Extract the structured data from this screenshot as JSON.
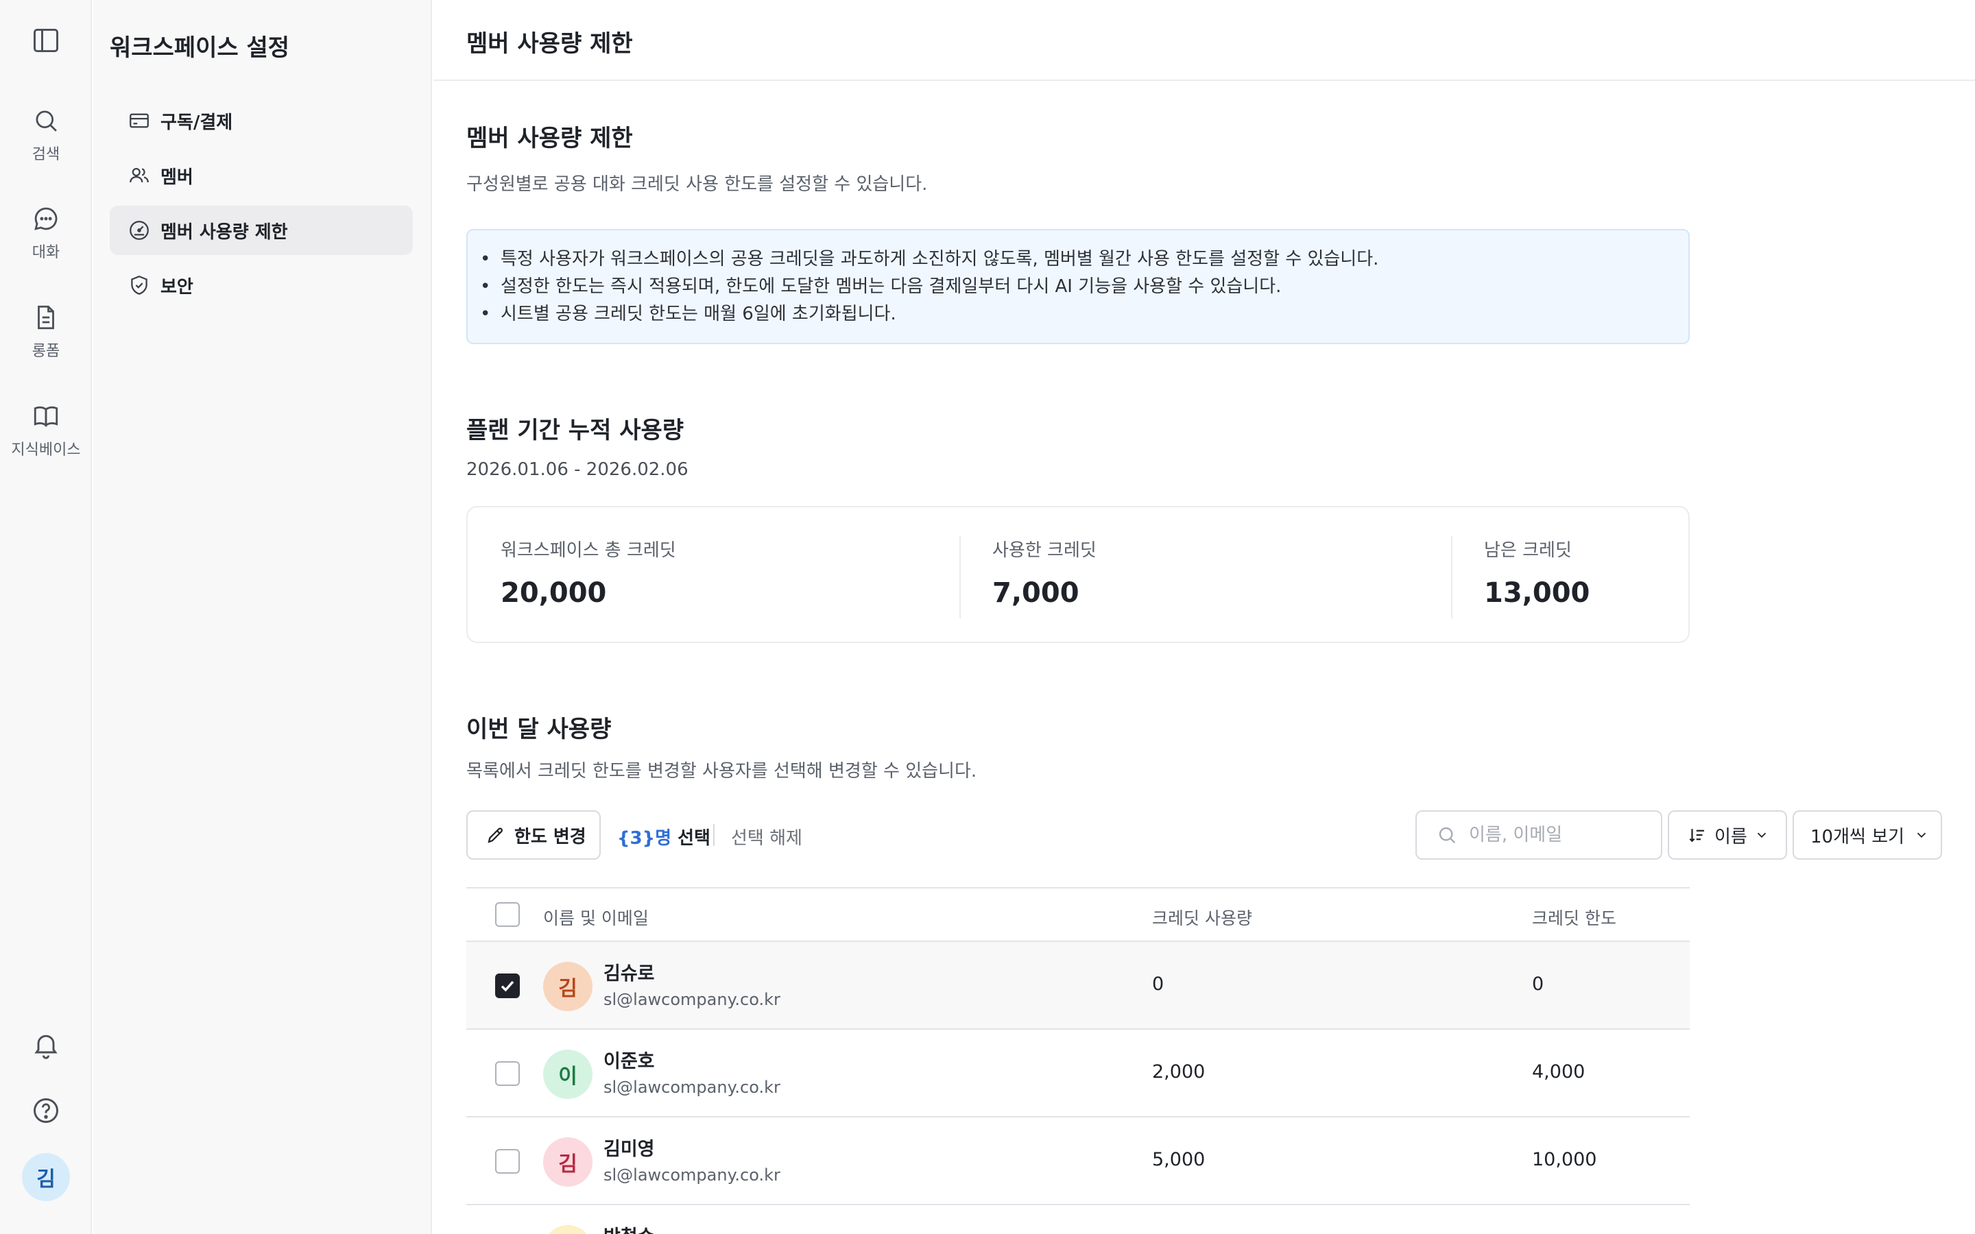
{
  "rail": {
    "items": [
      {
        "label": "검색",
        "icon": "search-icon"
      },
      {
        "label": "대화",
        "icon": "chat-icon"
      },
      {
        "label": "롱폼",
        "icon": "document-icon"
      },
      {
        "label": "지식베이스",
        "icon": "book-icon"
      }
    ],
    "avatar": "김"
  },
  "settings": {
    "title": "워크스페이스 설정",
    "nav": [
      {
        "label": "구독/결제",
        "icon": "credit-card-icon",
        "active": false
      },
      {
        "label": "멤버",
        "icon": "users-icon",
        "active": false
      },
      {
        "label": "멤버 사용량 제한",
        "icon": "gauge-icon",
        "active": true
      },
      {
        "label": "보안",
        "icon": "shield-icon",
        "active": false
      }
    ]
  },
  "header": {
    "title": "멤버 사용량 제한"
  },
  "section_limit": {
    "title": "멤버 사용량 제한",
    "desc": "구성원별로 공용 대화 크레딧 사용 한도를 설정할 수 있습니다.",
    "notices": [
      "특정 사용자가 워크스페이스의 공용 크레딧을 과도하게 소진하지 않도록, 멤버별 월간 사용 한도를 설정할 수 있습니다.",
      "설정한 한도는 즉시 적용되며, 한도에 도달한 멤버는 다음 결제일부터 다시 AI 기능을 사용할 수 있습니다.",
      "시트별 공용 크레딧 한도는 매월 6일에 초기화됩니다."
    ]
  },
  "section_plan": {
    "title": "플랜 기간 누적 사용량",
    "period": "2026.01.06 - 2026.02.06",
    "stats": [
      {
        "label": "워크스페이스 총 크레딧",
        "value": "20,000"
      },
      {
        "label": "사용한 크레딧",
        "value": "7,000"
      },
      {
        "label": "남은 크레딧",
        "value": "13,000"
      }
    ]
  },
  "section_month": {
    "title": "이번 달 사용량",
    "desc": "목록에서 크레딧 한도를 변경할 사용자를 선택해 변경할 수 있습니다."
  },
  "toolbar": {
    "edit_label": "한도 변경",
    "selected_prefix": "{3}명",
    "selected_suffix": " 선택",
    "clear_label": "선택 해제",
    "search_placeholder": "이름, 이메일",
    "sort_label": "이름",
    "page_size_label": "10개씩 보기"
  },
  "table": {
    "headers": {
      "name": "이름 및 이메일",
      "usage": "크레딧 사용량",
      "limit": "크레딧 한도"
    },
    "rows": [
      {
        "initial": "김",
        "name": "김슈로",
        "email": "sl@lawcompany.co.kr",
        "usage": "0",
        "limit": "0",
        "checked": true,
        "avatar_bg": "#f8d5bd",
        "avatar_fg": "#b5481b"
      },
      {
        "initial": "이",
        "name": "이준호",
        "email": "sl@lawcompany.co.kr",
        "usage": "2,000",
        "limit": "4,000",
        "checked": false,
        "avatar_bg": "#d5f3e1",
        "avatar_fg": "#1f7a45"
      },
      {
        "initial": "김",
        "name": "김미영",
        "email": "sl@lawcompany.co.kr",
        "usage": "5,000",
        "limit": "10,000",
        "checked": false,
        "avatar_bg": "#fbd9de",
        "avatar_fg": "#b52a44"
      },
      {
        "initial": "박",
        "name": "박철수",
        "email": "",
        "usage": "",
        "limit": "",
        "checked": false,
        "avatar_bg": "#fdf0c4",
        "avatar_fg": "#9b7a10"
      }
    ]
  },
  "colors": {
    "accent": "#2e6fd6",
    "notice_bg": "#f1f7fe"
  }
}
